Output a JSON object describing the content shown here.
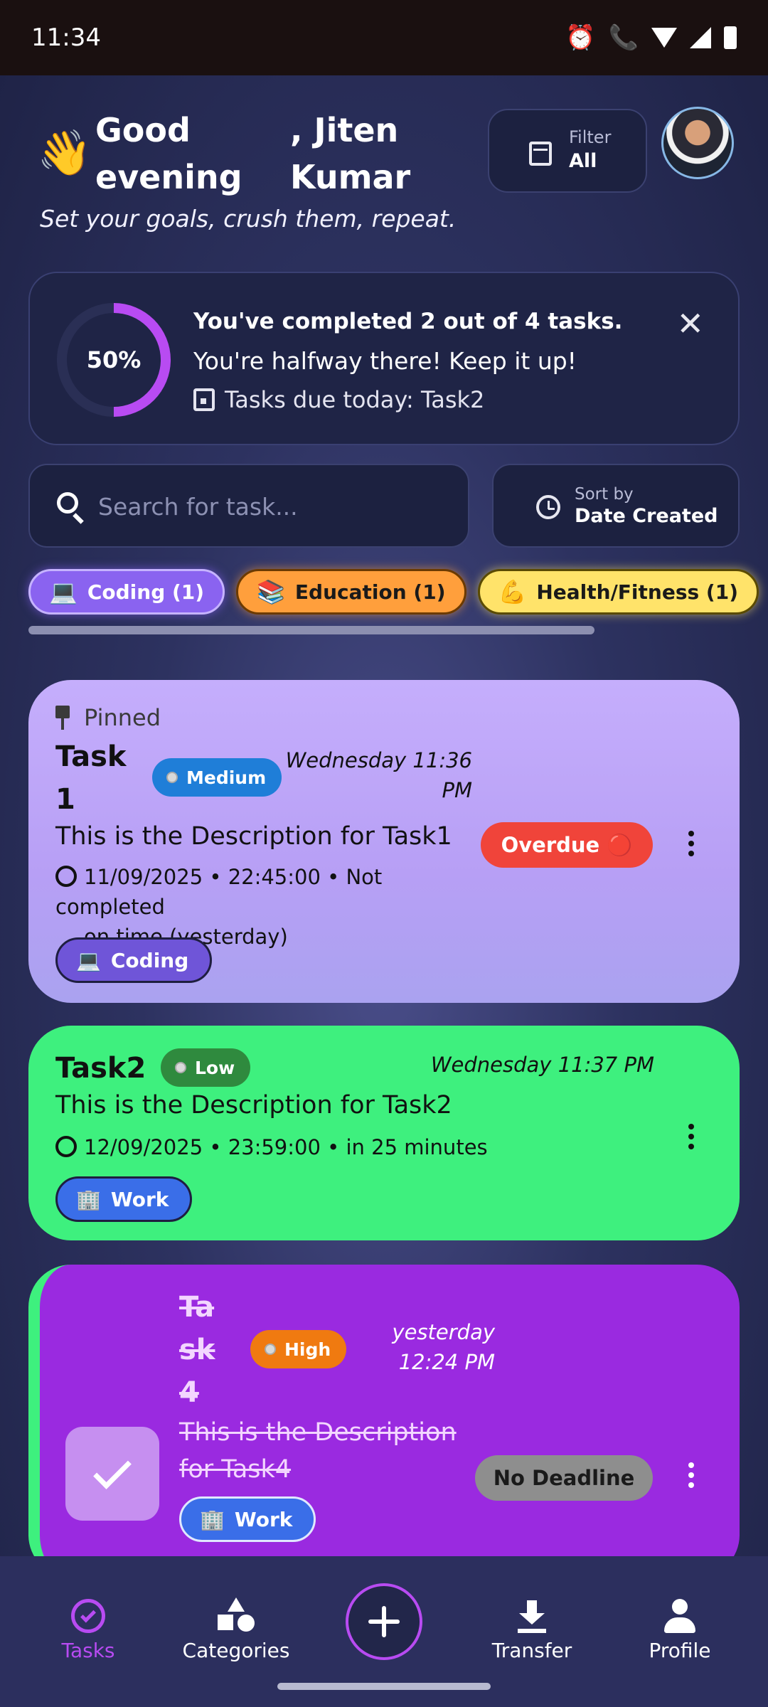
{
  "status": {
    "time": "11:34"
  },
  "header": {
    "wave": "👋",
    "greeting_part1": "Good evening",
    "greeting_part2": ", Jiten Kumar",
    "tagline": "Set your goals, crush them, repeat.",
    "filter_label": "Filter",
    "filter_value": "All"
  },
  "progress": {
    "percent_text": "50%",
    "percent": 0.5,
    "title": "You've completed 2 out of 4 tasks.",
    "subtitle": "You're halfway there! Keep it up!",
    "due_today": "Tasks due today: Task2"
  },
  "search": {
    "placeholder": "Search for task..."
  },
  "sort": {
    "label": "Sort by",
    "value": "Date Created"
  },
  "categories": [
    {
      "emoji": "💻",
      "label": "Coding (1)"
    },
    {
      "emoji": "📚",
      "label": "Education (1)"
    },
    {
      "emoji": "💪",
      "label": "Health/Fitness (1)"
    }
  ],
  "tasks": [
    {
      "pinned_label": "Pinned",
      "title_line1": "Task",
      "title_line2": "1",
      "priority": "Medium",
      "priority_color": "#1f7ed8",
      "date_line1": "Wednesday 11:36",
      "date_line2": "PM",
      "description": "This is the Description for Task1",
      "due_line1": "11/09/2025 • 22:45:00 • Not completed",
      "due_line2": "on time (yesterday)",
      "status_badge": "Overdue 🔴",
      "category_emoji": "💻",
      "category": "Coding"
    },
    {
      "title": "Task2",
      "priority": "Low",
      "priority_color": "#2f8a3e",
      "date": "Wednesday 11:37 PM",
      "description": "This is the Description for Task2",
      "due": "12/09/2025 • 23:59:00 • in 25 minutes",
      "category_emoji": "🏢",
      "category": "Work"
    },
    {
      "title_line1": "Ta",
      "title_line2": "sk",
      "title_line3": "4",
      "priority": "High",
      "priority_color": "#f07a10",
      "date_line1": "yesterday",
      "date_line2": "12:24 PM",
      "description_line1": "This is the Description",
      "description_line2": "for Task4",
      "status_badge": "No Deadline",
      "category_emoji": "🏢",
      "category": "Work"
    }
  ],
  "nav": {
    "tasks": "Tasks",
    "categories": "Categories",
    "transfer": "Transfer",
    "profile": "Profile"
  },
  "colors": {
    "accent": "#b84bf2",
    "overdue": "#f0443a",
    "no_deadline": "#8e8e8e"
  }
}
